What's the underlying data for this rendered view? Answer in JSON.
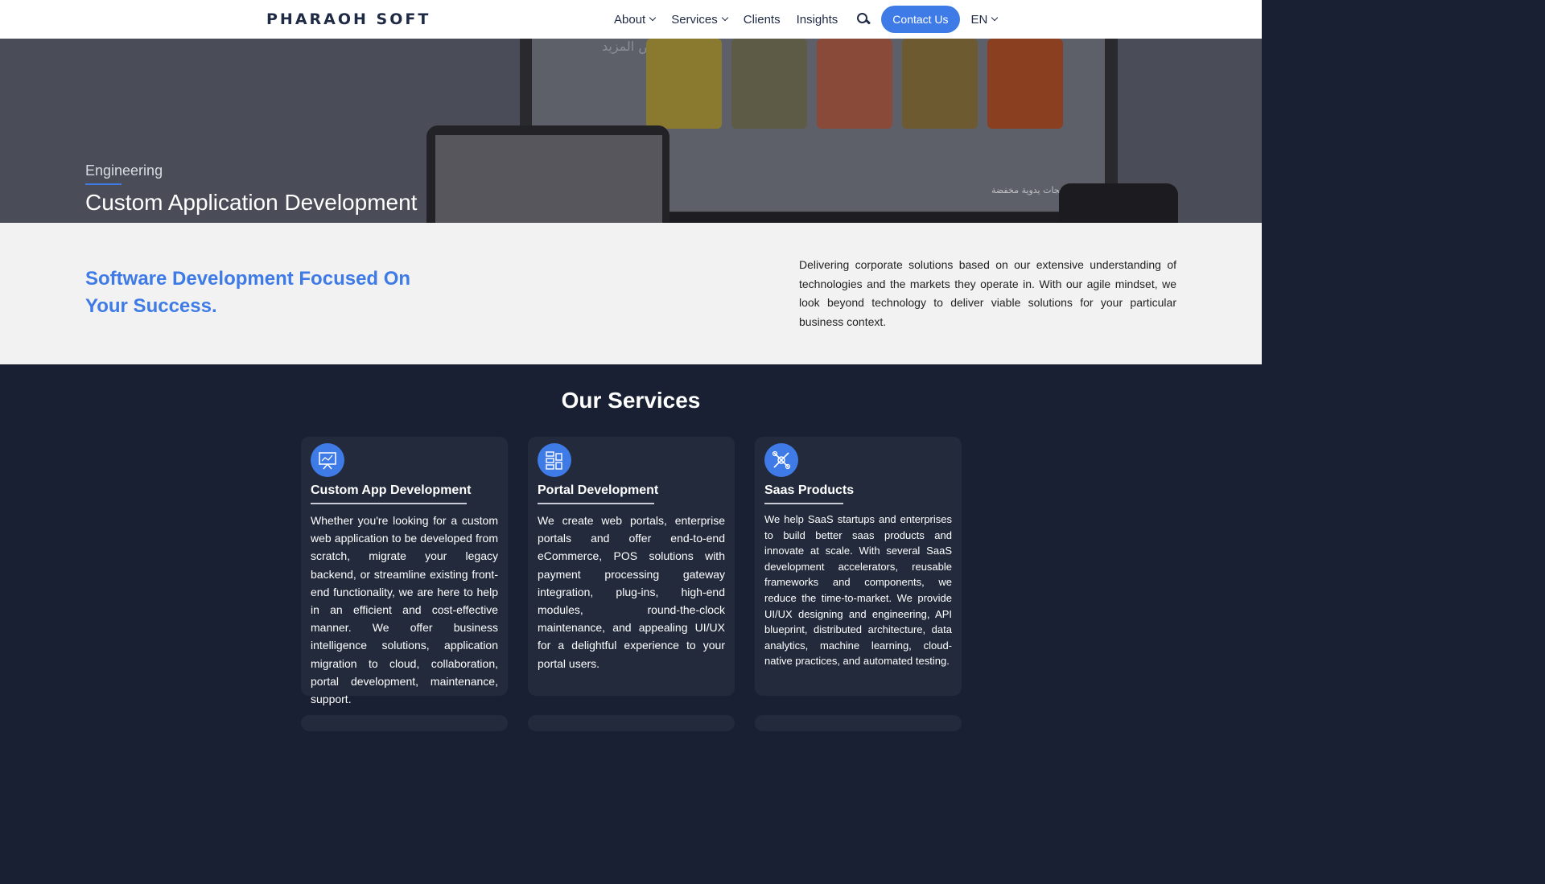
{
  "header": {
    "logo": "PHARAOH SOFT",
    "nav": {
      "about": "About",
      "services": "Services",
      "clients": "Clients",
      "insights": "Insights"
    },
    "contact_label": "Contact Us",
    "language": "EN"
  },
  "hero": {
    "arabic_more": "عرض المزيد",
    "arabic_sale": "منتجات يدوية مخفضة",
    "eyebrow": "Engineering",
    "title": "Custom Application Development"
  },
  "intro": {
    "heading": "Software Development Focused On Your Success.",
    "text": "Delivering corporate solutions based on our extensive understanding of technologies and the markets they operate in. With our agile mindset, we look beyond technology to deliver viable solutions for your particular business context."
  },
  "services": {
    "title": "Our Services",
    "cards": [
      {
        "title": "Custom App Development",
        "text": "Whether you're looking for a custom web application to be developed from scratch, migrate your legacy backend, or streamline existing front-end functionality, we are here to help in an efficient and cost-effective manner. We offer business intelligence solutions, application migration to cloud, collaboration, portal development, maintenance, support."
      },
      {
        "title": "Portal Development",
        "text": "We create web portals, enterprise portals and offer end-to-end eCommerce, POS solutions with payment processing gateway integration, plug-ins, high-end modules, round-the-clock maintenance, and appealing UI/UX for a delightful experience to your portal users."
      },
      {
        "title": "Saas Products",
        "text": "We help SaaS startups and enterprises to build better saas products and innovate at scale. With several SaaS development accelerators, reusable frameworks and components, we reduce the time-to-market. We provide UI/UX designing and engineering, API blueprint, distributed architecture, data analytics, machine learning, cloud-native practices, and automated testing."
      }
    ]
  },
  "colors": {
    "accent": "#3e7be6",
    "dark_bg": "#192033",
    "card_bg": "#222a3c",
    "intro_bg": "#f2f2f2"
  }
}
